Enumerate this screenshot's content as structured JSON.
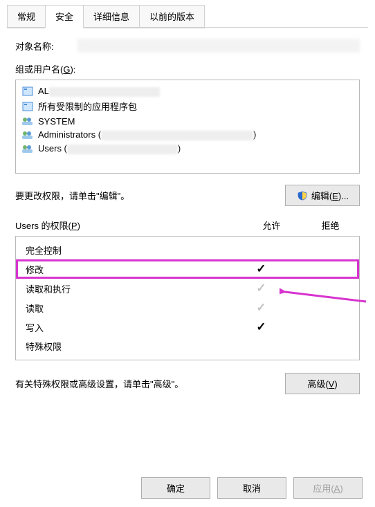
{
  "tabs": {
    "general": "常规",
    "security": "安全",
    "details": "详细信息",
    "previous": "以前的版本"
  },
  "object": {
    "label": "对象名称:"
  },
  "group": {
    "label_prefix": "组或用户名(",
    "label_key": "G",
    "label_suffix": "):",
    "items": [
      {
        "name_prefix": "AL",
        "blurred": true
      },
      {
        "name": "所有受限制的应用程序包",
        "blurred": false
      },
      {
        "name": "SYSTEM",
        "blurred": false
      },
      {
        "name_prefix": "Administrators (",
        "blurred": true,
        "suffix": ")"
      },
      {
        "name_prefix": "Users (",
        "blurred": true,
        "suffix": ")"
      }
    ]
  },
  "edit_hint": "要更改权限，请单击\"编辑\"。",
  "buttons": {
    "edit_prefix": "编辑(",
    "edit_key": "E",
    "edit_suffix": ")...",
    "advanced_prefix": "高级(",
    "advanced_key": "V",
    "advanced_suffix": ")",
    "ok": "确定",
    "cancel": "取消",
    "apply_prefix": "应用(",
    "apply_key": "A",
    "apply_suffix": ")"
  },
  "perm_header": {
    "name_prefix": "Users 的权限(",
    "name_key": "P",
    "name_suffix": ")",
    "allow": "允许",
    "deny": "拒绝"
  },
  "permissions": [
    {
      "name": "完全控制",
      "allow": "",
      "deny": ""
    },
    {
      "name": "修改",
      "allow": "✓",
      "deny": "",
      "highlight": true,
      "strong": true
    },
    {
      "name": "读取和执行",
      "allow": "✓",
      "deny": "",
      "gray": true
    },
    {
      "name": "读取",
      "allow": "✓",
      "deny": "",
      "gray": true
    },
    {
      "name": "写入",
      "allow": "✓",
      "deny": "",
      "strong": true
    },
    {
      "name": "特殊权限",
      "allow": "",
      "deny": ""
    }
  ],
  "adv_hint": "有关特殊权限或高级设置，请单击\"高级\"。"
}
